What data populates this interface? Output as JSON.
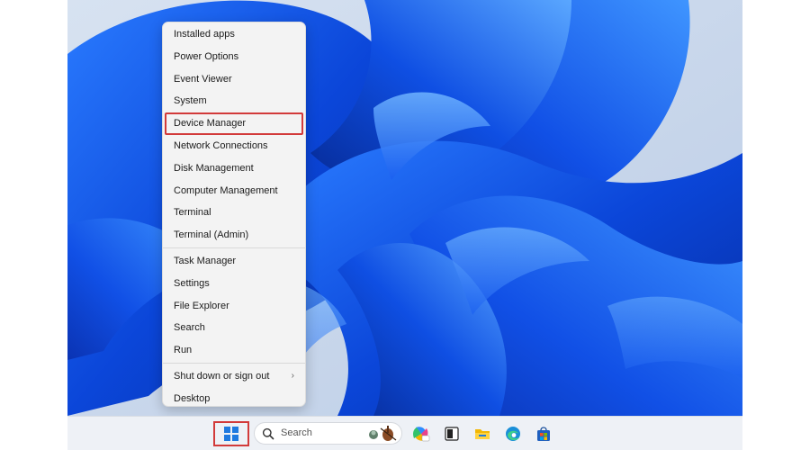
{
  "menu": {
    "items": [
      {
        "label": "Installed apps"
      },
      {
        "label": "Power Options"
      },
      {
        "label": "Event Viewer"
      },
      {
        "label": "System"
      },
      {
        "label": "Device Manager",
        "highlighted": true
      },
      {
        "label": "Network Connections"
      },
      {
        "label": "Disk Management"
      },
      {
        "label": "Computer Management"
      },
      {
        "label": "Terminal"
      },
      {
        "label": "Terminal (Admin)"
      },
      {
        "label": "Task Manager"
      },
      {
        "label": "Settings"
      },
      {
        "label": "File Explorer"
      },
      {
        "label": "Search"
      },
      {
        "label": "Run"
      },
      {
        "label": "Shut down or sign out",
        "has_submenu": true
      },
      {
        "label": "Desktop"
      }
    ]
  },
  "taskbar": {
    "search_label": "Search",
    "pinned_icons": [
      "copilot-icon",
      "task-view-icon",
      "file-explorer-icon",
      "edge-icon",
      "store-icon"
    ]
  },
  "colors": {
    "highlight_border": "#d23a3a",
    "windows_blue": "#1f7ae0",
    "wallpaper_blue": "#1447d6"
  }
}
